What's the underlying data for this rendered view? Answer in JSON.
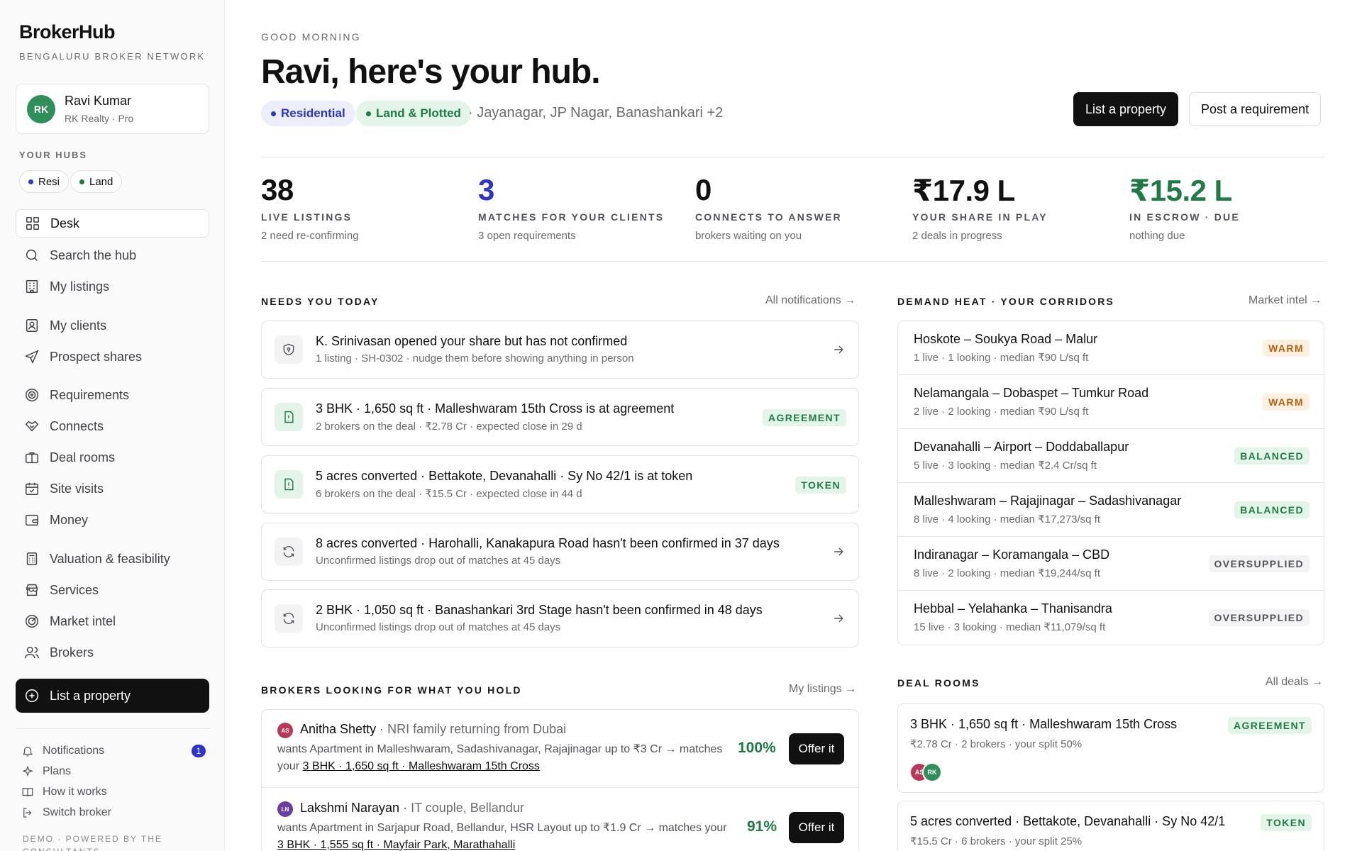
{
  "brand": {
    "name": "BrokerHub",
    "subtitle": "BENGALURU BROKER NETWORK"
  },
  "user": {
    "initials": "RK",
    "name": "Ravi Kumar",
    "meta": "RK Realty · Pro"
  },
  "sidebar": {
    "hubs_label": "YOUR HUBS",
    "hubs": [
      {
        "label": "Resi",
        "color": "#2d34c9"
      },
      {
        "label": "Land",
        "color": "#1f7a45"
      }
    ],
    "nav": [
      {
        "label": "Desk",
        "icon": "grid-icon"
      },
      {
        "label": "Search the hub",
        "icon": "search-icon"
      },
      {
        "label": "My listings",
        "icon": "building-icon"
      },
      {
        "label": "My clients",
        "icon": "contact-icon"
      },
      {
        "label": "Prospect shares",
        "icon": "send-icon"
      },
      {
        "label": "Requirements",
        "icon": "target-icon"
      },
      {
        "label": "Connects",
        "icon": "handshake-icon"
      },
      {
        "label": "Deal rooms",
        "icon": "briefcase-icon"
      },
      {
        "label": "Site visits",
        "icon": "calendar-icon"
      },
      {
        "label": "Money",
        "icon": "wallet-icon"
      },
      {
        "label": "Valuation & feasibility",
        "icon": "calculator-icon"
      },
      {
        "label": "Services",
        "icon": "store-icon"
      },
      {
        "label": "Market intel",
        "icon": "radar-icon"
      },
      {
        "label": "Brokers",
        "icon": "users-icon"
      }
    ],
    "cta": "List a property",
    "footer": [
      {
        "label": "Notifications",
        "icon": "bell-icon",
        "count": "1"
      },
      {
        "label": "Plans",
        "icon": "sparkle-icon"
      },
      {
        "label": "How it works",
        "icon": "book-icon"
      },
      {
        "label": "Switch broker",
        "icon": "logout-icon"
      }
    ],
    "demo_note": "DEMO · POWERED BY THE CONSULTANTS"
  },
  "header": {
    "greeting": "GOOD MORNING",
    "headline": "Ravi, here's your hub.",
    "chips": [
      {
        "label": "Residential"
      },
      {
        "label": "Land & Plotted"
      }
    ],
    "areas": "· Jayanagar, JP Nagar, Banashankari +2",
    "primary_button": "List a property",
    "secondary_button": "Post a requirement"
  },
  "stats": [
    {
      "value": "38",
      "label": "LIVE LISTINGS",
      "sub": "2 need re-confirming",
      "color": "#111111"
    },
    {
      "value": "3",
      "label": "MATCHES FOR YOUR CLIENTS",
      "sub": "3 open requirements",
      "color": "#2d34c9"
    },
    {
      "value": "0",
      "label": "CONNECTS TO ANSWER",
      "sub": "brokers waiting on you",
      "color": "#111111"
    },
    {
      "value": "₹17.9 L",
      "label": "YOUR SHARE IN PLAY",
      "sub": "2 deals in progress",
      "color": "#111111"
    },
    {
      "value": "₹15.2 L",
      "label": "IN ESCROW · DUE",
      "sub": "nothing due",
      "color": "#1f7a45"
    }
  ],
  "needs_today": {
    "title": "NEEDS YOU TODAY",
    "link": "All notifications →",
    "items": [
      {
        "icon": "shield-icon",
        "title": "K. Srinivasan opened your share but has not confirmed",
        "sub": "1 listing · SH-0302 · nudge them before showing anything in person",
        "tag": ""
      },
      {
        "icon": "alert-file-icon",
        "title": "3 BHK · 1,650 sq ft · Malleshwaram 15th Cross is at agreement",
        "sub": "2 brokers on the deal · ₹2.78 Cr · expected close in 29 d",
        "tag": "AGREEMENT"
      },
      {
        "icon": "alert-file-icon",
        "title": "5 acres converted · Bettakote, Devanahalli · Sy No 42/1 is at token",
        "sub": "6 brokers on the deal · ₹15.5 Cr · expected close in 44 d",
        "tag": "TOKEN"
      },
      {
        "icon": "refresh-icon",
        "title": "8 acres converted · Harohalli, Kanakapura Road hasn't been confirmed in 37 days",
        "sub": "Unconfirmed listings drop out of matches at 45 days",
        "tag": ""
      },
      {
        "icon": "refresh-icon",
        "title": "2 BHK · 1,050 sq ft · Banashankari 3rd Stage hasn't been confirmed in 48 days",
        "sub": "Unconfirmed listings drop out of matches at 45 days",
        "tag": ""
      }
    ]
  },
  "demand_heat": {
    "title": "DEMAND HEAT · YOUR CORRIDORS",
    "link": "Market intel →",
    "rows": [
      {
        "name": "Hoskote – Soukya Road – Malur",
        "meta": "1 live · 1 looking · median ₹90 L/sq ft",
        "tag": "WARM",
        "kind": "warm"
      },
      {
        "name": "Nelamangala – Dobaspet – Tumkur Road",
        "meta": "2 live · 2 looking · median ₹90 L/sq ft",
        "tag": "WARM",
        "kind": "warm"
      },
      {
        "name": "Devanahalli – Airport – Doddaballapur",
        "meta": "5 live · 3 looking · median ₹2.4 Cr/sq ft",
        "tag": "BALANCED",
        "kind": "green"
      },
      {
        "name": "Malleshwaram – Rajajinagar – Sadashivanagar",
        "meta": "8 live · 4 looking · median ₹17,273/sq ft",
        "tag": "BALANCED",
        "kind": "green"
      },
      {
        "name": "Indiranagar – Koramangala – CBD",
        "meta": "8 live · 2 looking · median ₹19,244/sq ft",
        "tag": "OVERSUPPLIED",
        "kind": "gray"
      },
      {
        "name": "Hebbal – Yelahanka – Thanisandra",
        "meta": "15 live · 3 looking · median ₹11,079/sq ft",
        "tag": "OVERSUPPLIED",
        "kind": "gray"
      }
    ]
  },
  "brokers_looking": {
    "title": "BROKERS LOOKING FOR WHAT YOU HOLD",
    "link": "My listings →",
    "rows": [
      {
        "initials": "AS",
        "avatar_color": "#b9385a",
        "name": "Anitha Shetty",
        "context": "· NRI family returning from Dubai",
        "desc": "wants Apartment in Malleshwaram, Sadashivanagar, Rajajinagar up to ₹3 Cr → matches your",
        "listing": "3 BHK · 1,650 sq ft · Malleshwaram 15th Cross",
        "match": "100%",
        "button": "Offer it"
      },
      {
        "initials": "LN",
        "avatar_color": "#6b3fa0",
        "name": "Lakshmi Narayan",
        "context": "· IT couple, Bellandur",
        "desc": "wants Apartment in Sarjapur Road, Bellandur, HSR Layout up to ₹1.9 Cr → matches your",
        "listing": "3 BHK · 1,555 sq ft · Mayfair Park, Marathahalli",
        "match": "91%",
        "button": "Offer it"
      }
    ]
  },
  "deal_rooms": {
    "title": "DEAL ROOMS",
    "link": "All deals →",
    "deals": [
      {
        "title": "3 BHK · 1,650 sq ft · Malleshwaram 15th Cross",
        "meta": "₹2.78 Cr · 2 brokers · your split 50%",
        "tag": "AGREEMENT",
        "avatars": [
          {
            "initials": "AS",
            "color": "#b9385a"
          },
          {
            "initials": "RK",
            "color": "#2f8f5a"
          }
        ]
      },
      {
        "title": "5 acres converted · Bettakote, Devanahalli · Sy No 42/1",
        "meta": "₹15.5 Cr · 6 brokers · your split 25%",
        "tag": "TOKEN",
        "avatars": []
      }
    ]
  }
}
